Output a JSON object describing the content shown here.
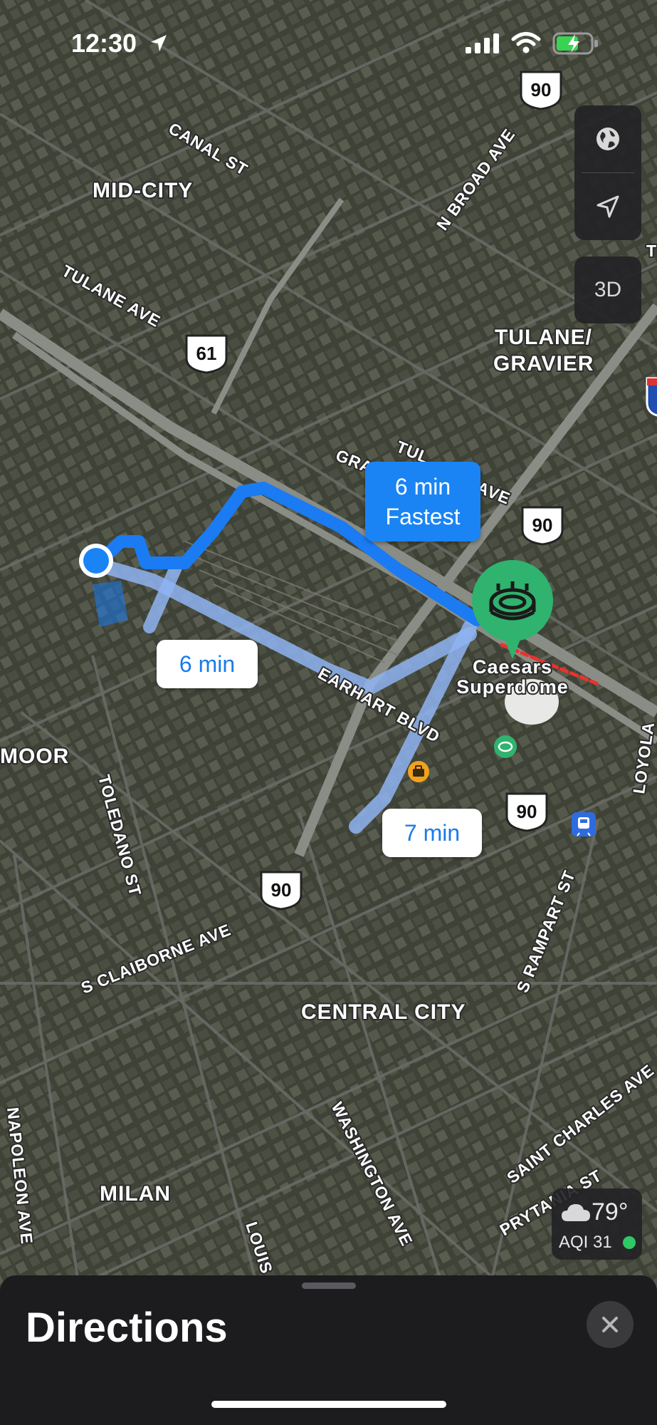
{
  "status_bar": {
    "time": "12:30"
  },
  "map": {
    "neighborhoods": {
      "mid_city": "MID-CITY",
      "tulane_gravier_1": "TULANE/",
      "tulane_gravier_2": "GRAVIER",
      "central_city": "CENTRAL CITY",
      "milan": "MILAN",
      "moor": "MOOR"
    },
    "streets": {
      "canal": "CANAL ST",
      "n_broad": "N BROAD AVE",
      "tulane": "TULANE AVE",
      "gravier": "GRA",
      "tulane_ave_right": "TUL",
      "ave_right": "AVE",
      "earhart": "EARHART BLVD",
      "toledano": "TOLEDANO ST",
      "s_claiborne": "S CLAIBORNE AVE",
      "s_rampart": "S RAMPART ST",
      "washington": "WASHINGTON AVE",
      "saint_charles": "SAINT CHARLES AVE",
      "prytania": "PRYTANIA ST",
      "napoleon": "NAPOLEON AVE",
      "louisiana": "LOUIS",
      "loyola": "LOYOLA",
      "edge_t": "T"
    },
    "shields": {
      "us90_top": "90",
      "us90_mid": "90",
      "us90_lower": "90",
      "us90_bottom": "90",
      "us61": "61"
    },
    "destination": {
      "name_line1": "Caesars",
      "name_line2": "Superdome"
    },
    "routes": [
      {
        "time": "6 min",
        "tag": "Fastest"
      },
      {
        "time": "6 min"
      },
      {
        "time": "7 min"
      }
    ],
    "colors": {
      "route_primary": "#1a7bf2",
      "route_alt": "#8fb4f2",
      "destination_pin": "#2fb36f",
      "user_location": "#1a84f5"
    }
  },
  "controls": {
    "globe_icon": "globe-icon",
    "location_icon": "location-arrow-icon",
    "view_3d": "3D"
  },
  "weather": {
    "temperature": "79°",
    "aqi": "AQI 31",
    "aqi_color": "#2ec866"
  },
  "sheet": {
    "title": "Directions"
  }
}
